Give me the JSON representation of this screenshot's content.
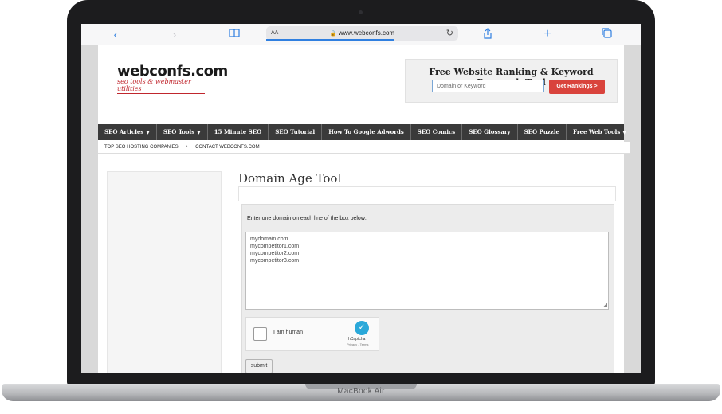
{
  "device": {
    "label": "MacBook Air"
  },
  "browser": {
    "text_size": "AA",
    "url": "www.webconfs.com",
    "icons": [
      "back-icon",
      "forward-icon",
      "bookmarks-icon",
      "lock-icon",
      "reload-icon",
      "share-icon",
      "new-tab-icon",
      "tabs-icon"
    ]
  },
  "site": {
    "logo": {
      "name": "webconfs.com",
      "tagline": "seo tools & webmaster utilities"
    },
    "ranking_tool": {
      "title": "Free Website Ranking & Keyword Research Tool",
      "placeholder": "Domain or Keyword",
      "button": "Get Rankings >"
    },
    "nav": [
      {
        "label": "SEO Articles",
        "dropdown": true
      },
      {
        "label": "SEO Tools",
        "dropdown": true
      },
      {
        "label": "15 Minute SEO",
        "dropdown": false
      },
      {
        "label": "SEO Tutorial",
        "dropdown": false
      },
      {
        "label": "How To Google Adwords",
        "dropdown": false
      },
      {
        "label": "SEO Comics",
        "dropdown": false
      },
      {
        "label": "SEO Glossary",
        "dropdown": false
      },
      {
        "label": "SEO Puzzle",
        "dropdown": false
      },
      {
        "label": "Free Web Tools",
        "dropdown": true
      }
    ],
    "subnav": [
      "TOP SEO HOSTING COMPANIES",
      "•",
      "CONTACT WEBCONFS.COM"
    ],
    "content": {
      "title": "Domain Age Tool",
      "instruction": "Enter one domain on each line of the box below:",
      "domains": [
        "mydomain.com",
        "mycompetitor1.com",
        "mycompetitor2.com",
        "mycompetitor3.com"
      ],
      "captcha": {
        "label": "I am human",
        "brand": "hCaptcha",
        "terms": "Privacy - Terms"
      },
      "submit": "submit"
    }
  }
}
